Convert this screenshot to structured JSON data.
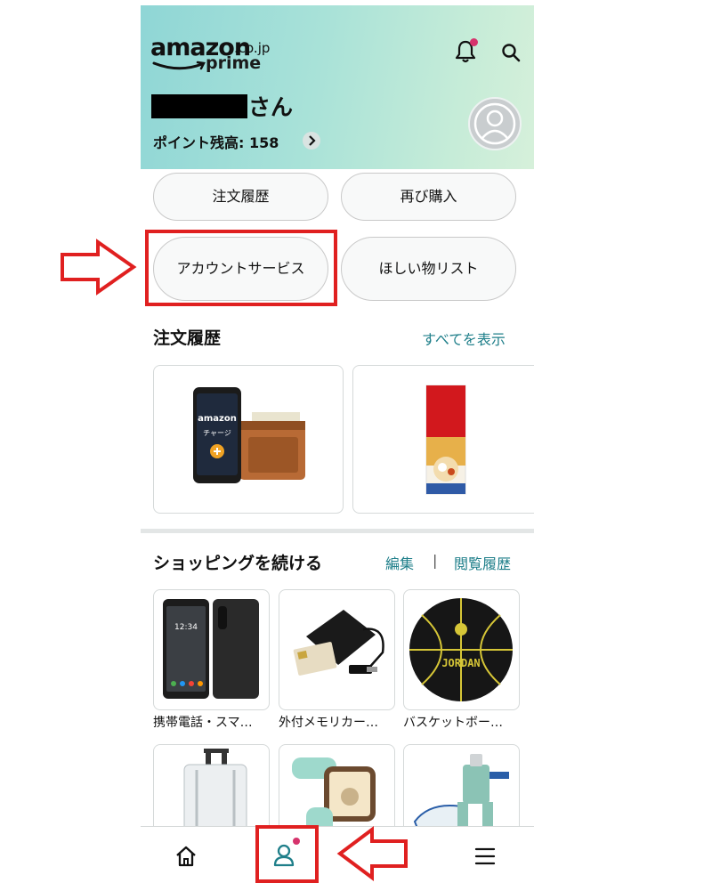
{
  "header": {
    "logo_word": "amazon",
    "logo_domain": ".co.jp",
    "logo_prime": "prime",
    "user_suffix": "さん",
    "points_label": "ポイント残高: 158"
  },
  "quick_buttons": {
    "order_history": "注文履歴",
    "buy_again": "再び購入",
    "account_service": "アカウントサービス",
    "wishlist": "ほしい物リスト"
  },
  "orders": {
    "title": "注文履歴",
    "view_all": "すべてを表示",
    "item1_brand": "amazon",
    "item1_sub": "チャージ"
  },
  "continue_shopping": {
    "title": "ショッピングを続ける",
    "edit": "編集",
    "separator": "|",
    "history": "閲覧履歴",
    "items": [
      {
        "label": "携帯電話・スマ…"
      },
      {
        "label": "外付メモリカー…"
      },
      {
        "label": "バスケットボー…"
      }
    ],
    "jordan_text": "JORDAN",
    "phone_time": "12:34"
  },
  "bottom_nav": {
    "home": "home-icon",
    "account": "person-icon",
    "menu": "menu-icon"
  },
  "colors": {
    "accent_link": "#1f7f8a",
    "badge": "#d6336c",
    "annotation": "#e02020"
  }
}
